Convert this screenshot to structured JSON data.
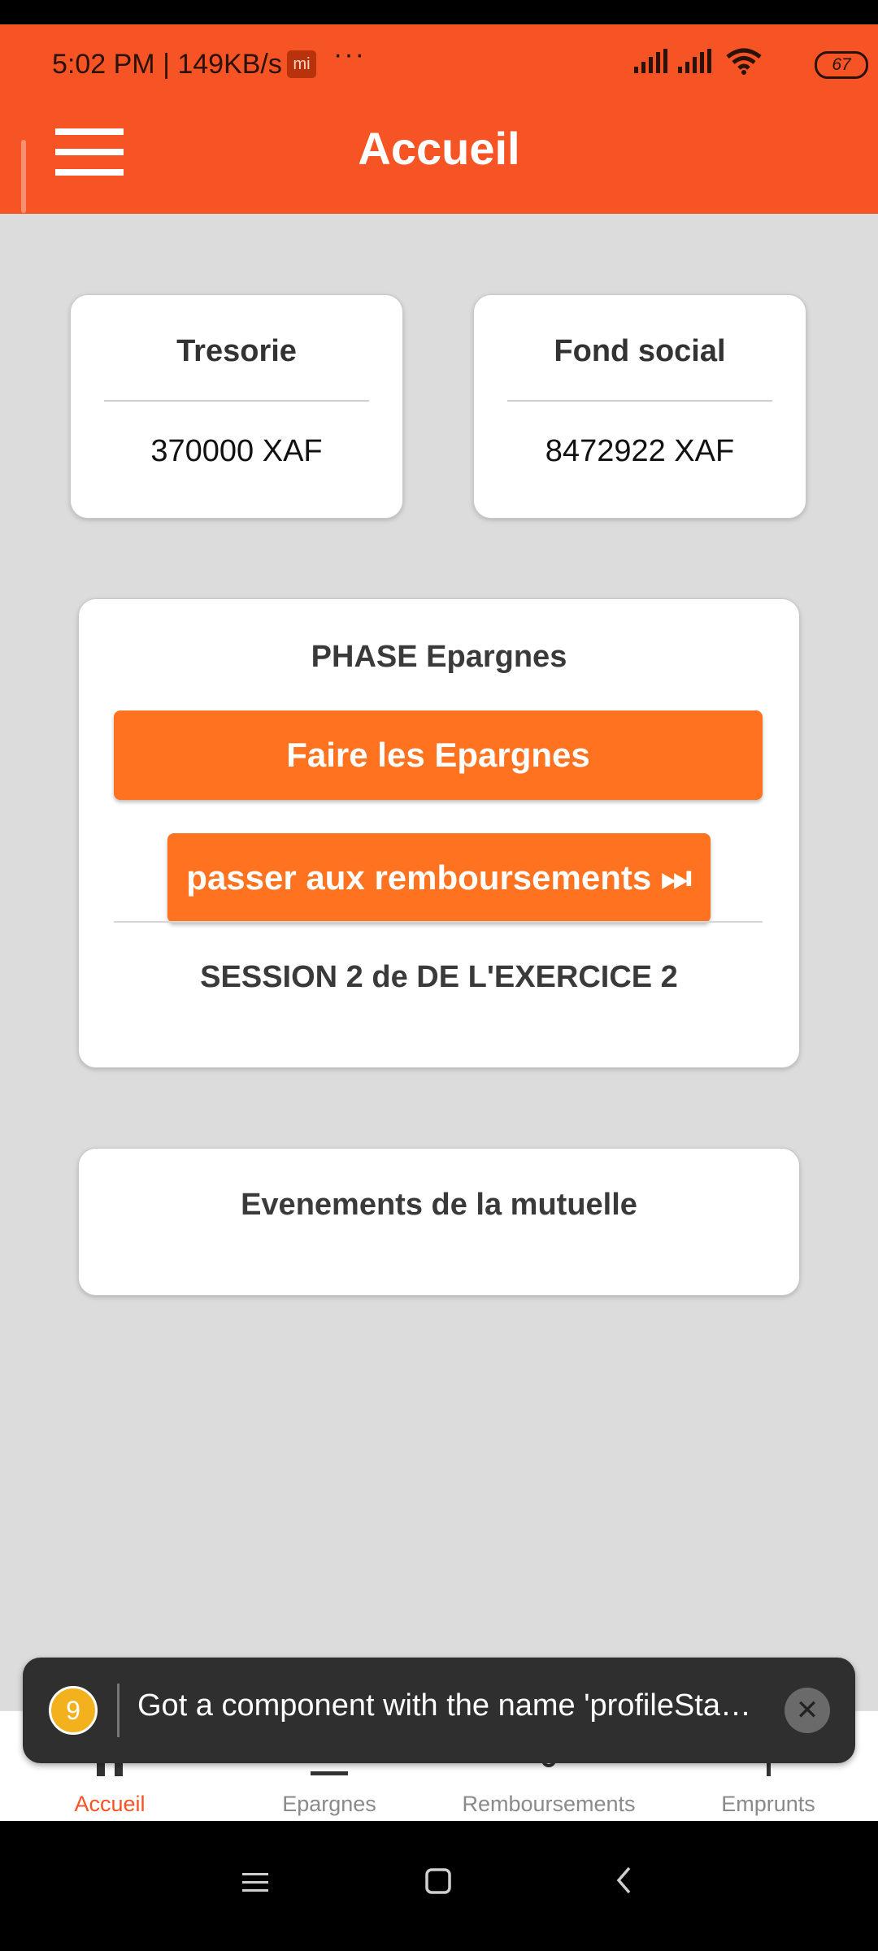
{
  "status_bar": {
    "time_speed": "5:02 PM | 149KB/s",
    "mi_badge": "mi",
    "more": "···",
    "battery": "67"
  },
  "header": {
    "title": "Accueil",
    "menu_icon": "hamburger-menu-icon"
  },
  "stats": {
    "tresorie": {
      "label": "Tresorie",
      "value": "370000 XAF"
    },
    "fond_social": {
      "label": "Fond social",
      "value": "8472922 XAF"
    }
  },
  "phase": {
    "title": "PHASE Epargnes",
    "primary_button": "Faire les Epargnes",
    "secondary_button": "passer aux remboursements ⏭",
    "session_text": "SESSION 2 de DE L'EXERCICE 2"
  },
  "events": {
    "title": "Evenements de la mutuelle"
  },
  "bottom_nav": {
    "items": [
      {
        "label": "Accueil",
        "icon": "home-icon",
        "active": true
      },
      {
        "label": "Epargnes",
        "icon": "savings-icon",
        "active": false
      },
      {
        "label": "Remboursements",
        "icon": "refund-icon",
        "active": false
      },
      {
        "label": "Emprunts",
        "icon": "loan-icon",
        "active": false
      }
    ]
  },
  "toast": {
    "badge": "9",
    "message": "Got a component with the name 'profileSta…"
  },
  "colors": {
    "accent": "#f65425",
    "button": "#ff7220",
    "background": "#dcdcdc"
  }
}
